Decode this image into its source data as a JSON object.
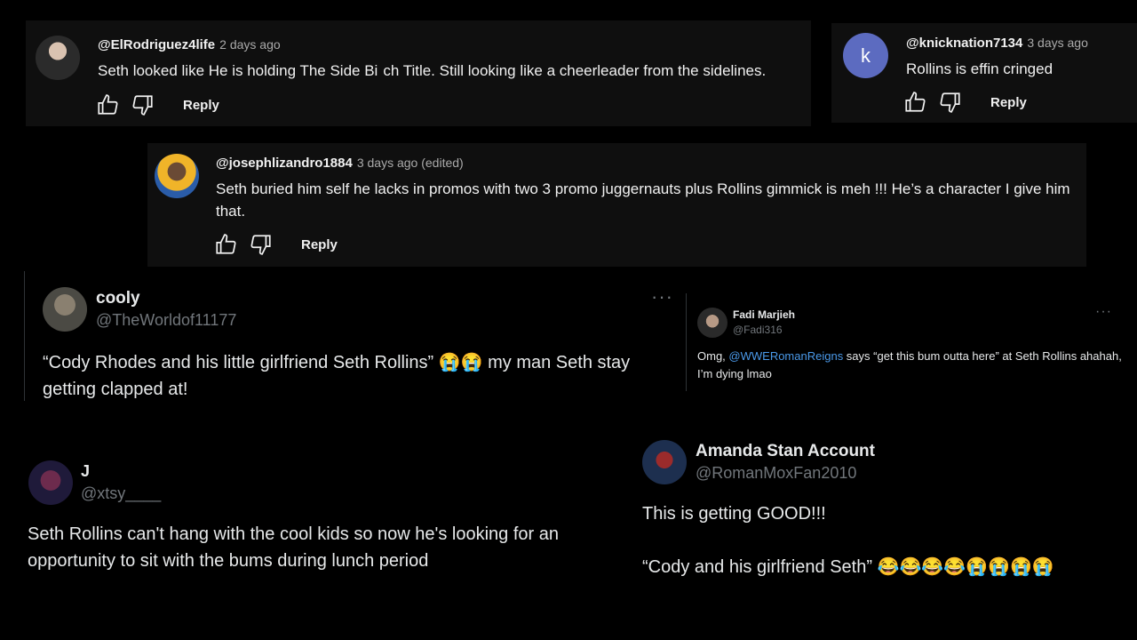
{
  "comments": [
    {
      "handle": "@ElRodriguez4life",
      "time": "2 days ago",
      "text_a": "Seth looked like He is holding The Side Bi",
      "text_b": "ch Title. Still looking like a cheerleader from the sidelines.",
      "reply": "Reply"
    },
    {
      "avatar_letter": "k",
      "handle": "@knicknation7134",
      "time": "3 days ago",
      "text": "Rollins is effin cringed",
      "reply": "Reply"
    },
    {
      "handle": "@josephlizandro1884",
      "time": "3 days ago (edited)",
      "text": "Seth buried him self he lacks in promos with two 3 promo juggernauts plus Rollins gimmick is meh !!! He’s a character I give him that.",
      "reply": "Reply"
    }
  ],
  "tweets": [
    {
      "name": "cooly",
      "handle": "@TheWorldof11177",
      "text": "“Cody Rhodes and his little girlfriend Seth Rollins” 😭😭 my man Seth stay getting clapped at!",
      "more": "···"
    },
    {
      "name": "Fadi Marjieh",
      "handle": "@Fadi316",
      "text_pre": "Omg, ",
      "mention": "@WWERomanReigns",
      "text_post": " says “get this bum outta here” at Seth Rollins ahahah, I’m dying lmao",
      "more": "···"
    },
    {
      "name": "J",
      "handle": "@xtsy____",
      "text": "Seth Rollins can't hang with the cool kids so now he's looking for an opportunity to sit with the bums during lunch period"
    },
    {
      "name": "Amanda Stan Account",
      "handle": "@RomanMoxFan2010",
      "line1": "This is getting GOOD!!!",
      "line2": "“Cody and his girlfriend Seth” 😂😂😂😂😭😭😭😭"
    }
  ]
}
